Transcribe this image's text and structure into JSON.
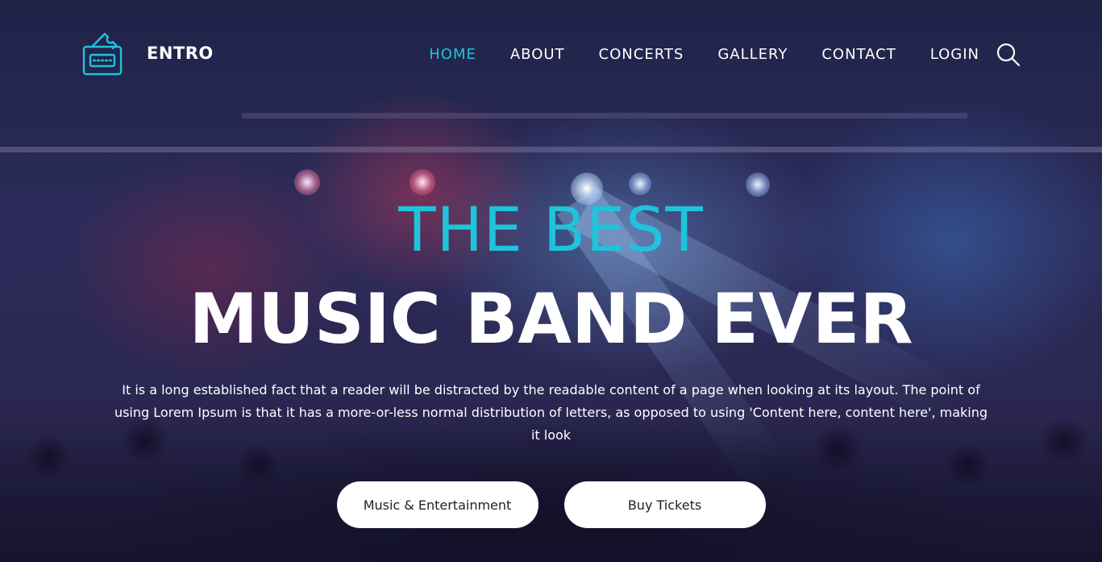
{
  "brand": {
    "name": "ENTRO",
    "logo_icon": "ticket-icon",
    "accent_color": "#1fc3db"
  },
  "nav": {
    "items": [
      {
        "label": "HOME",
        "active": true
      },
      {
        "label": "ABOUT",
        "active": false
      },
      {
        "label": "CONCERTS",
        "active": false
      },
      {
        "label": "GALLERY",
        "active": false
      },
      {
        "label": "CONTACT",
        "active": false
      },
      {
        "label": "LOGIN",
        "active": false
      }
    ],
    "search_icon": "search-icon"
  },
  "hero": {
    "headline_top": "THE BEST",
    "headline_main": "MUSIC BAND EVER",
    "description": "It is a long established fact that a reader will be distracted by the readable content of a page when looking at its layout. The point of using Lorem Ipsum is that it has a more-or-less normal distribution of letters, as opposed to using 'Content here, content here', making it look",
    "buttons": [
      {
        "label": "Music & Entertainment"
      },
      {
        "label": "Buy Tickets"
      }
    ]
  }
}
